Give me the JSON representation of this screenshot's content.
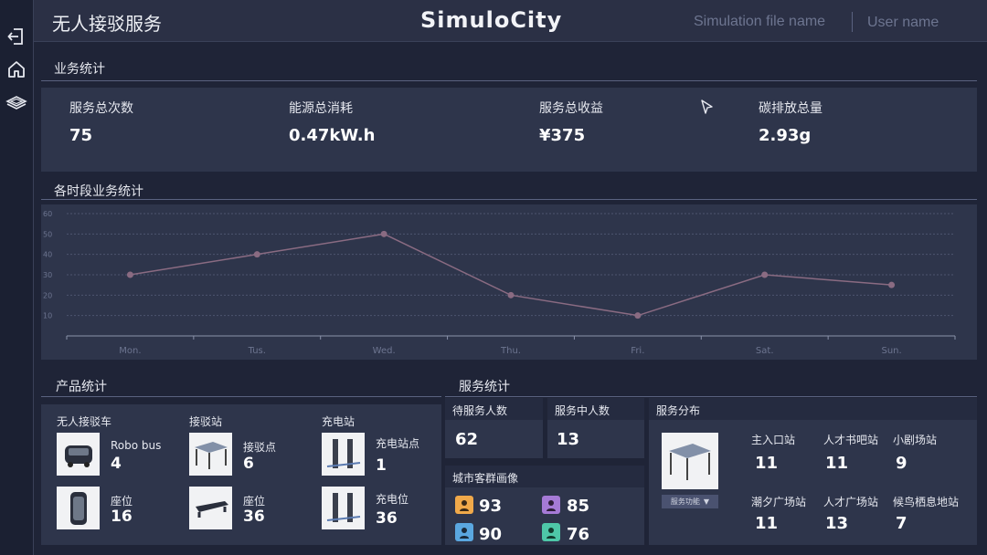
{
  "header": {
    "app_title": "无人接驳服务",
    "logo": "SimuloCity",
    "file_name": "Simulation file name",
    "user_name": "User name"
  },
  "rail": {
    "icons": [
      "exit-icon",
      "home-icon",
      "layers-icon"
    ]
  },
  "business": {
    "title": "业务统计",
    "kpis": [
      {
        "label": "服务总次数",
        "value": "75"
      },
      {
        "label": "能源总消耗",
        "value": "0.47kW.h"
      },
      {
        "label": "服务总收益",
        "value": "¥375"
      },
      {
        "label": "碳排放总量",
        "value": "2.93g"
      }
    ]
  },
  "period": {
    "title": "各时段业务统计",
    "chart_data": {
      "type": "line",
      "categories": [
        "Mon.",
        "Tus.",
        "Wed.",
        "Thu.",
        "Fri.",
        "Sat.",
        "Sun."
      ],
      "values": [
        30,
        40,
        50,
        20,
        10,
        30,
        25
      ],
      "yticks": [
        10,
        20,
        30,
        40,
        50,
        60
      ],
      "ylim": [
        0,
        60
      ],
      "grid": true,
      "line_color": "#8a6b82"
    }
  },
  "product": {
    "title": "产品统计",
    "groups": [
      {
        "title": "无人接驳车",
        "items": [
          {
            "label": "Robo bus",
            "value": "4"
          },
          {
            "label": "座位",
            "value": "16"
          }
        ]
      },
      {
        "title": "接驳站",
        "items": [
          {
            "label": "接驳点",
            "value": "6"
          },
          {
            "label": "座位",
            "value": "36"
          }
        ]
      },
      {
        "title": "充电站",
        "items": [
          {
            "label": "充电站点",
            "value": "1"
          },
          {
            "label": "充电位",
            "value": "36"
          }
        ]
      }
    ]
  },
  "service": {
    "title": "服务统计",
    "waiting": {
      "label": "待服务人数",
      "value": "62"
    },
    "serving": {
      "label": "服务中人数",
      "value": "13"
    },
    "personas": {
      "label": "城市客群画像",
      "items": [
        {
          "value": "93",
          "color": "#f0a94a"
        },
        {
          "value": "85",
          "color": "#a57ad6"
        },
        {
          "value": "90",
          "color": "#5aa7e0"
        },
        {
          "value": "76",
          "color": "#4ec7a8"
        }
      ]
    },
    "distribution": {
      "label": "服务分布",
      "select_label": "服务功能",
      "stations": [
        {
          "label": "主入口站",
          "value": "11"
        },
        {
          "label": "人才书吧站",
          "value": "11"
        },
        {
          "label": "小剧场站",
          "value": "9"
        },
        {
          "label": "潮夕广场站",
          "value": "11"
        },
        {
          "label": "人才广场站",
          "value": "13"
        },
        {
          "label": "候鸟栖息地站",
          "value": "7"
        }
      ]
    }
  }
}
